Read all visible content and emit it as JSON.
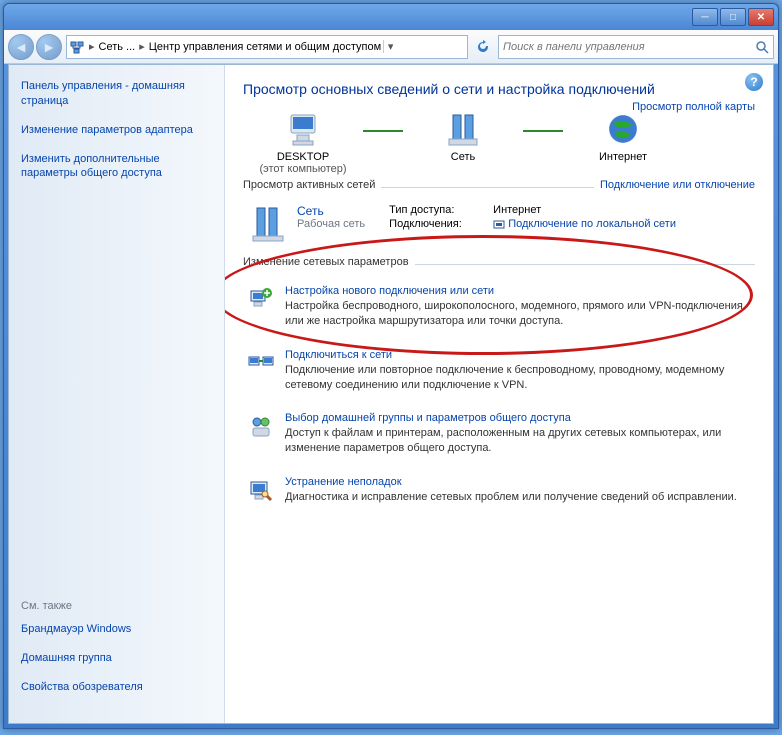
{
  "breadcrumb": {
    "part1": "Сеть ...",
    "part2": "Центр управления сетями и общим доступом"
  },
  "search": {
    "placeholder": "Поиск в панели управления"
  },
  "sidebar": {
    "home": "Панель управления - домашняя страница",
    "adapter": "Изменение параметров адаптера",
    "sharing": "Изменить дополнительные параметры общего доступа",
    "see_also": "См. также",
    "firewall": "Брандмауэр Windows",
    "homegroup": "Домашняя группа",
    "browser_props": "Свойства обозревателя"
  },
  "main": {
    "title": "Просмотр основных сведений о сети и настройка подключений",
    "fullmap": "Просмотр полной карты",
    "net": {
      "desktop": "DESKTOP",
      "desktop_sub": "(этот компьютер)",
      "network": "Сеть",
      "internet": "Интернет"
    },
    "active_header": "Просмотр активных сетей",
    "connect_toggle": "Подключение или отключение",
    "active": {
      "name": "Сеть",
      "type": "Рабочая сеть",
      "access_k": "Тип доступа:",
      "access_v": "Интернет",
      "conn_k": "Подключения:",
      "conn_v": "Подключение по локальной сети"
    },
    "change_header": "Изменение сетевых параметров",
    "items": [
      {
        "title": "Настройка нового подключения или сети",
        "desc": "Настройка беспроводного, широкополосного, модемного, прямого или VPN-подключения или же настройка маршрутизатора или точки доступа."
      },
      {
        "title": "Подключиться к сети",
        "desc": "Подключение или повторное подключение к беспроводному, проводному, модемному сетевому соединению или подключение к VPN."
      },
      {
        "title": "Выбор домашней группы и параметров общего доступа",
        "desc": "Доступ к файлам и принтерам, расположенным на других сетевых компьютерах, или изменение параметров общего доступа."
      },
      {
        "title": "Устранение неполадок",
        "desc": "Диагностика и исправление сетевых проблем или получение сведений об исправлении."
      }
    ]
  }
}
